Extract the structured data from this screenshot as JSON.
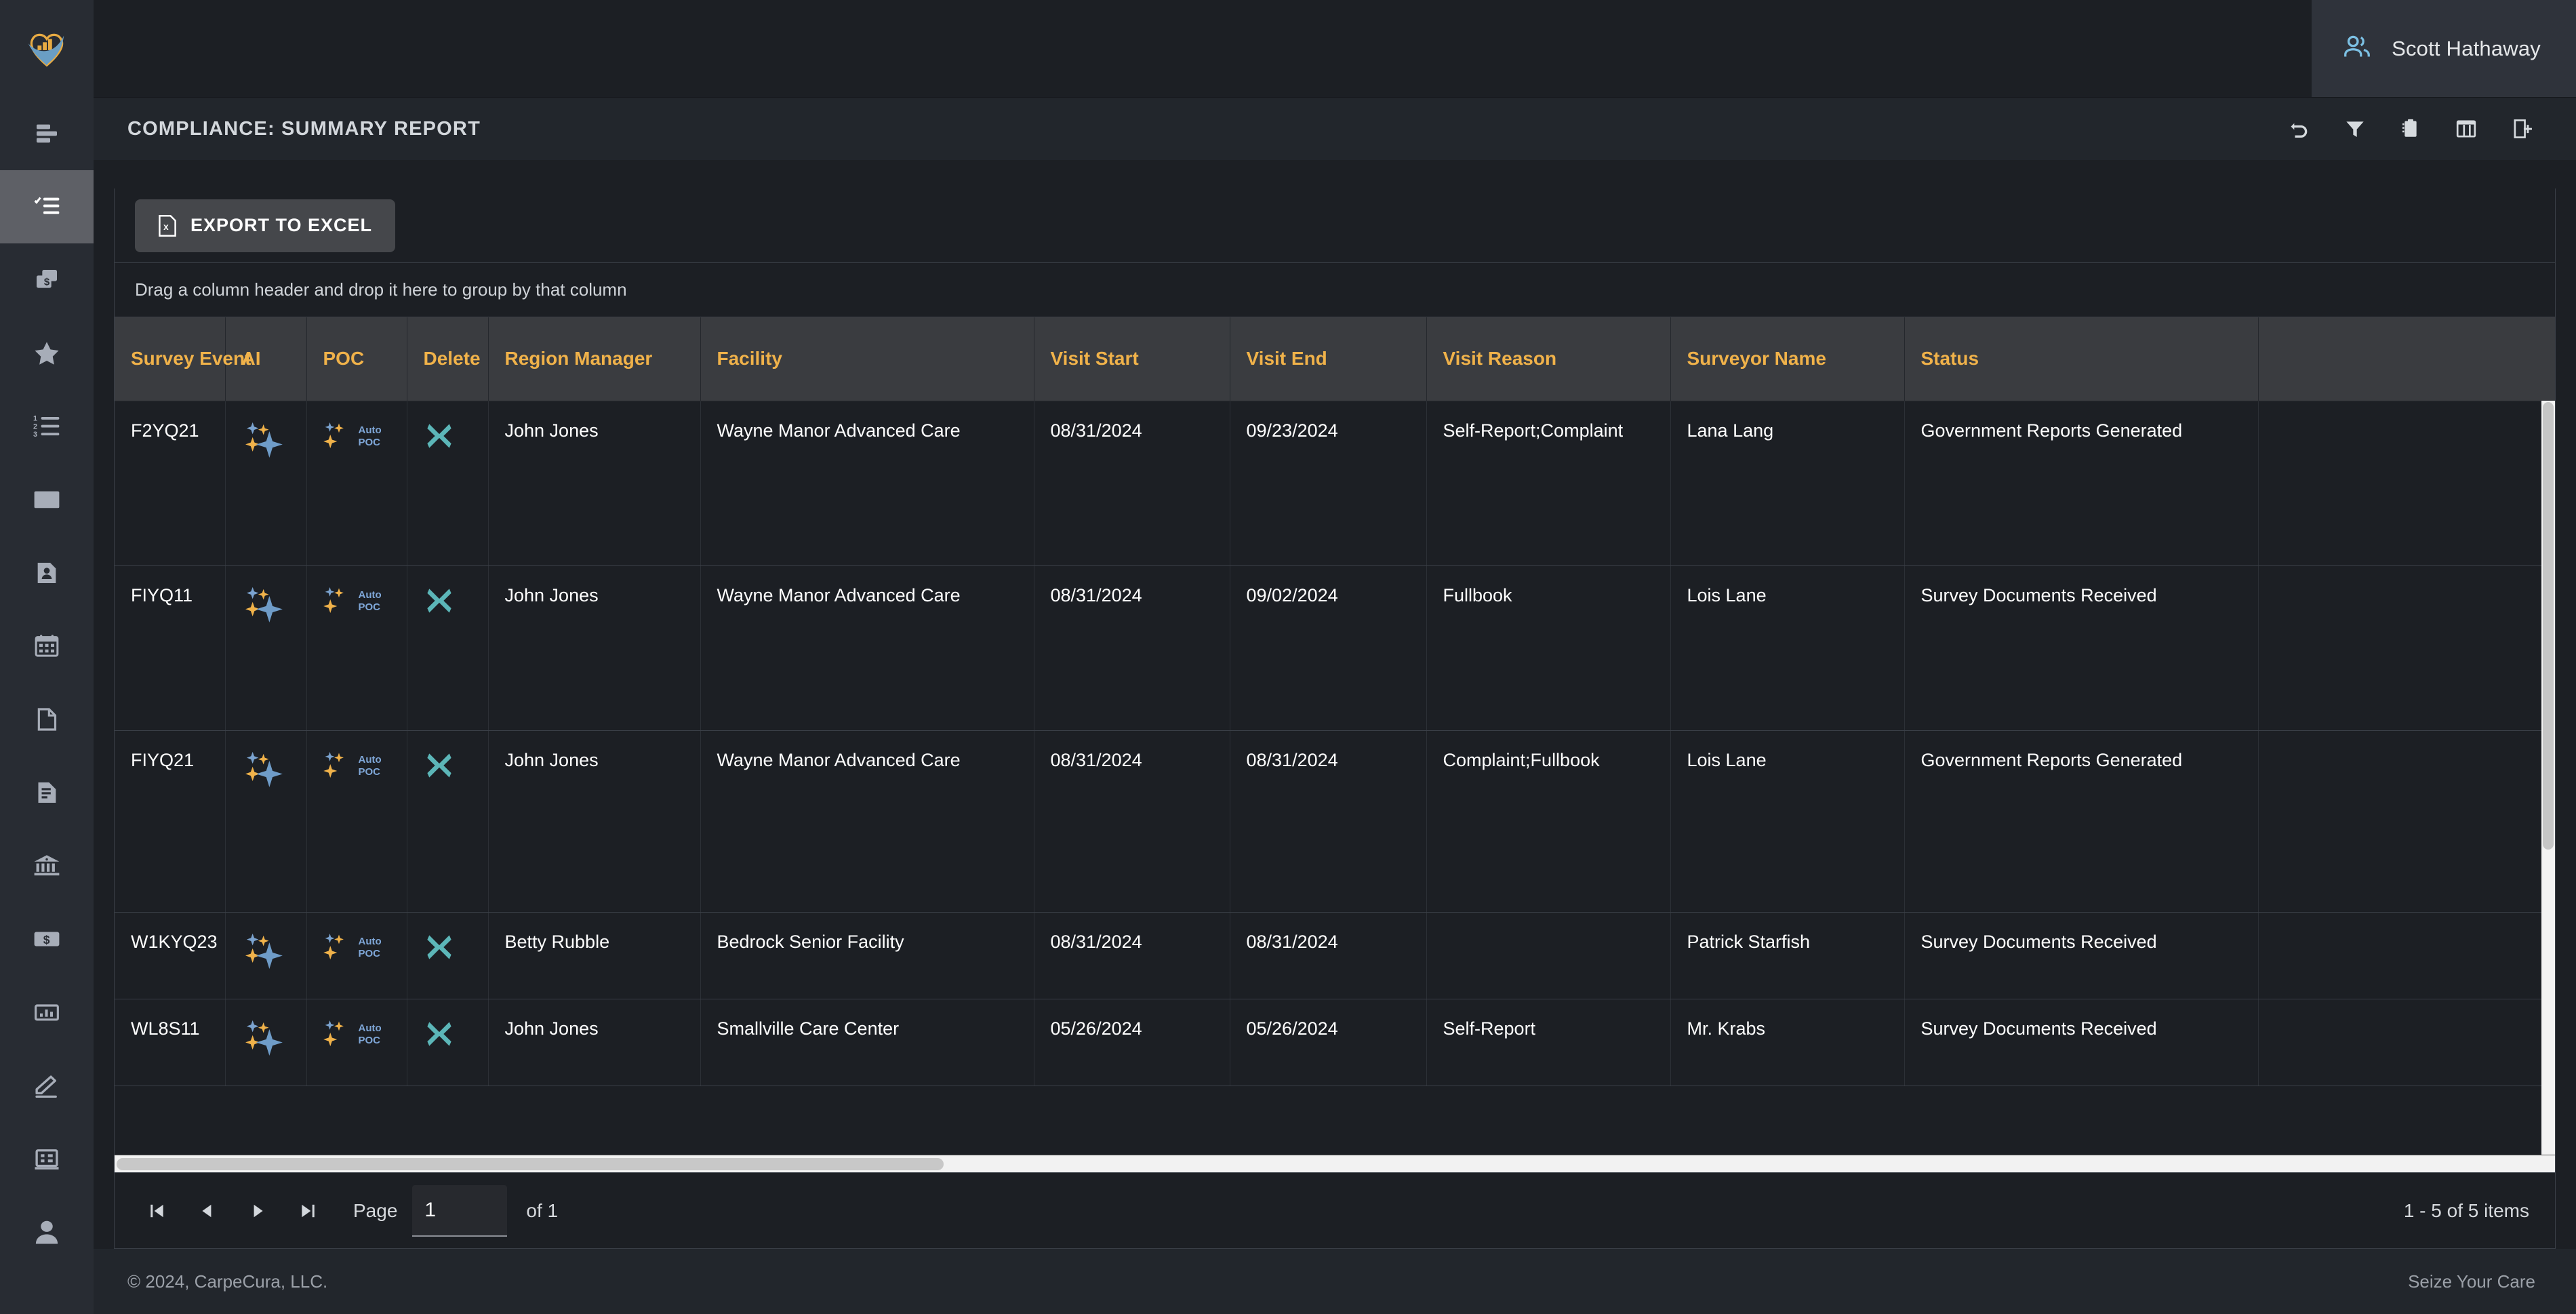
{
  "brand": {
    "logo_name": "carpecura-heart-logo",
    "accent_gold": "#f0b24a",
    "accent_blue": "#74a7cf",
    "accent_teal": "#5cb6b8"
  },
  "topbar": {
    "user_icon": "users-icon",
    "user_name": "Scott Hathaway"
  },
  "titlebar": {
    "title": "COMPLIANCE: SUMMARY REPORT",
    "tools": [
      {
        "name": "undo-icon",
        "label": "Undo"
      },
      {
        "name": "filter-icon",
        "label": "Filter"
      },
      {
        "name": "clipboard-icon",
        "label": "Clipboard"
      },
      {
        "name": "table-icon",
        "label": "Table"
      },
      {
        "name": "add-document-icon",
        "label": "Add Document"
      }
    ]
  },
  "toolbar": {
    "export_label": "EXPORT TO EXCEL",
    "export_icon": "excel-file-icon"
  },
  "grid": {
    "group_hint": "Drag a column header and drop it here to group by that column",
    "columns": [
      "Survey Event",
      "AI",
      "POC",
      "Delete",
      "Region Manager",
      "Facility",
      "Visit Start",
      "Visit End",
      "Visit Reason",
      "Surveyor Name",
      "Status"
    ],
    "rows": [
      {
        "survey_event": "F2YQ21",
        "ai": "ai-sparkle-icon",
        "poc": "Auto POC",
        "delete": "delete-x-icon",
        "region_manager": "John Jones",
        "facility": "Wayne Manor Advanced Care",
        "visit_start": "08/31/2024",
        "visit_end": "09/23/2024",
        "visit_reason": "Self-Report;Complaint",
        "surveyor_name": "Lana Lang",
        "status": "Government Reports Generated"
      },
      {
        "survey_event": "FIYQ11",
        "ai": "ai-sparkle-icon",
        "poc": "Auto POC",
        "delete": "delete-x-icon",
        "region_manager": "John Jones",
        "facility": "Wayne Manor Advanced Care",
        "visit_start": "08/31/2024",
        "visit_end": "09/02/2024",
        "visit_reason": "Fullbook",
        "surveyor_name": "Lois Lane",
        "status": "Survey Documents Received"
      },
      {
        "survey_event": "FIYQ21",
        "ai": "ai-sparkle-icon",
        "poc": "Auto POC",
        "delete": "delete-x-icon",
        "region_manager": "John Jones",
        "facility": "Wayne Manor Advanced Care",
        "visit_start": "08/31/2024",
        "visit_end": "08/31/2024",
        "visit_reason": "Complaint;Fullbook",
        "surveyor_name": "Lois Lane",
        "status": "Government Reports Generated"
      },
      {
        "survey_event": "W1KYQ23",
        "ai": "ai-sparkle-icon",
        "poc": "Auto POC",
        "delete": "delete-x-icon",
        "region_manager": "Betty Rubble",
        "facility": "Bedrock Senior Facility",
        "visit_start": "08/31/2024",
        "visit_end": "08/31/2024",
        "visit_reason": "",
        "surveyor_name": "Patrick Starfish",
        "status": "Survey Documents Received"
      },
      {
        "survey_event": "WL8S11",
        "ai": "ai-sparkle-icon",
        "poc": "Auto POC",
        "delete": "delete-x-icon",
        "region_manager": "John Jones",
        "facility": "Smallville Care Center",
        "visit_start": "05/26/2024",
        "visit_end": "05/26/2024",
        "visit_reason": "Self-Report",
        "surveyor_name": "Mr. Krabs",
        "status": "Survey Documents Received"
      }
    ]
  },
  "pager": {
    "first_icon": "first-page-icon",
    "prev_icon": "previous-page-icon",
    "next_icon": "next-page-icon",
    "last_icon": "last-page-icon",
    "page_label": "Page",
    "page_value": "1",
    "of_label": "of 1",
    "item_count": "1 - 5 of 5 items"
  },
  "sidebar": {
    "items": [
      {
        "name": "sidebar-item-align-list",
        "icon": "align-list-icon",
        "active": false
      },
      {
        "name": "sidebar-item-checklist",
        "icon": "checklist-icon",
        "active": true
      },
      {
        "name": "sidebar-item-billing-copy",
        "icon": "copy-dollar-icon",
        "active": false
      },
      {
        "name": "sidebar-item-favorites",
        "icon": "star-icon",
        "active": false
      },
      {
        "name": "sidebar-item-numbered-list",
        "icon": "numbered-list-icon",
        "active": false
      },
      {
        "name": "sidebar-item-mail",
        "icon": "envelope-icon",
        "active": false
      },
      {
        "name": "sidebar-item-contacts",
        "icon": "contact-card-icon",
        "active": false
      },
      {
        "name": "sidebar-item-calendar",
        "icon": "calendar-icon",
        "active": false
      },
      {
        "name": "sidebar-item-blank-document",
        "icon": "blank-document-icon",
        "active": false
      },
      {
        "name": "sidebar-item-text-document",
        "icon": "text-document-icon",
        "active": false
      },
      {
        "name": "sidebar-item-government",
        "icon": "bank-icon",
        "active": false
      },
      {
        "name": "sidebar-item-finance",
        "icon": "money-bill-icon",
        "active": false
      },
      {
        "name": "sidebar-item-reports",
        "icon": "bar-chart-icon",
        "active": false
      },
      {
        "name": "sidebar-item-signature",
        "icon": "pencil-icon",
        "active": false
      },
      {
        "name": "sidebar-item-facilities",
        "icon": "building-icon",
        "active": false
      },
      {
        "name": "sidebar-item-profile",
        "icon": "user-icon",
        "active": false
      }
    ]
  },
  "footer": {
    "copyright": "© 2024, CarpeCura, LLC.",
    "tagline": "Seize Your Care"
  }
}
